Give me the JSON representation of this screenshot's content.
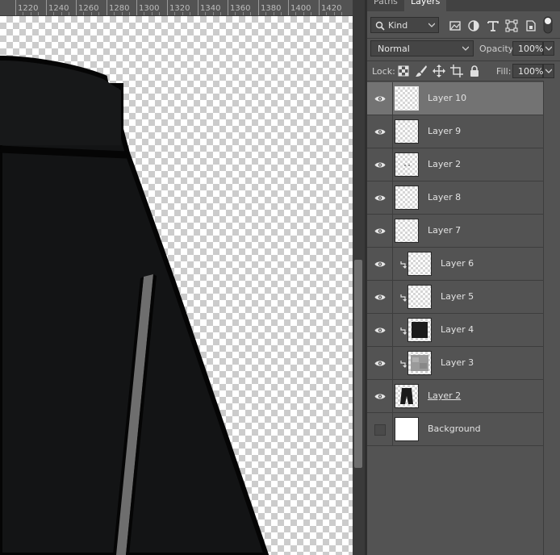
{
  "ruler": {
    "labels": [
      "1220",
      "1240",
      "1260",
      "1280",
      "1300",
      "1320",
      "1340",
      "1360",
      "1380",
      "1400",
      "1420"
    ]
  },
  "panel": {
    "tabs": [
      "Paths",
      "Layers"
    ],
    "kind_label": "Kind",
    "blend_mode": "Normal",
    "opacity_label": "Opacity:",
    "opacity_value": "100%",
    "lock_label": "Lock:",
    "fill_label": "Fill:",
    "fill_value": "100%"
  },
  "layers": [
    {
      "name": "Layer 10",
      "visible": true,
      "selected": true,
      "clipped": false,
      "thumb": "transparent"
    },
    {
      "name": "Layer 9",
      "visible": true,
      "selected": false,
      "clipped": false,
      "thumb": "transparent"
    },
    {
      "name": "Layer 2",
      "visible": true,
      "selected": false,
      "clipped": false,
      "thumb": "dots"
    },
    {
      "name": "Layer 8",
      "visible": true,
      "selected": false,
      "clipped": false,
      "thumb": "transparent"
    },
    {
      "name": "Layer 7",
      "visible": true,
      "selected": false,
      "clipped": false,
      "thumb": "transparent"
    },
    {
      "name": "Layer 6",
      "visible": true,
      "selected": false,
      "clipped": true,
      "thumb": "transparent"
    },
    {
      "name": "Layer 5",
      "visible": true,
      "selected": false,
      "clipped": true,
      "thumb": "transparent"
    },
    {
      "name": "Layer 4",
      "visible": true,
      "selected": false,
      "clipped": true,
      "thumb": "black"
    },
    {
      "name": "Layer 3",
      "visible": true,
      "selected": false,
      "clipped": true,
      "thumb": "gray"
    },
    {
      "name": "Layer 2",
      "visible": true,
      "selected": false,
      "clipped": false,
      "thumb": "shorts",
      "underline": true
    },
    {
      "name": "Background",
      "visible": false,
      "selected": false,
      "clipped": false,
      "thumb": "white"
    }
  ],
  "colors": {
    "panel_bg": "#535353",
    "selected_row": "#737373",
    "garment": "#131415"
  }
}
